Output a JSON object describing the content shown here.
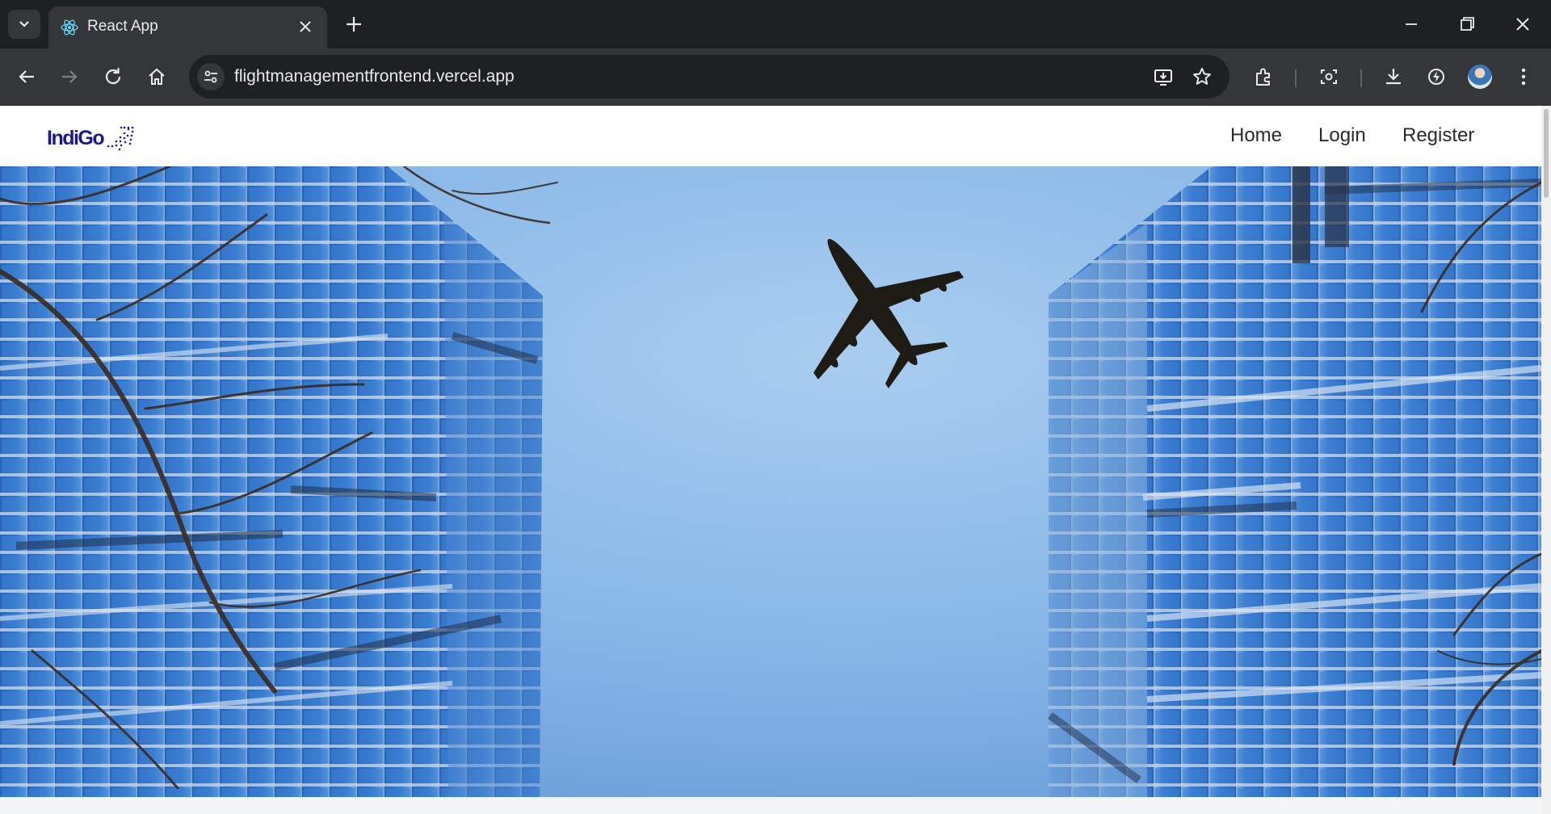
{
  "browser": {
    "tab": {
      "title": "React App",
      "favicon": "react-icon",
      "close_icon": "close-icon"
    },
    "new_tab_icon": "plus-icon",
    "window_controls": [
      "minimize-icon",
      "restore-icon",
      "close-icon"
    ],
    "nav_icons": [
      "back-arrow-icon",
      "forward-arrow-icon",
      "reload-icon",
      "home-icon"
    ],
    "address": {
      "url": "flightmanagementfrontend.vercel.app",
      "site_info_icon": "tune-icon"
    },
    "omnibox_icons": [
      "install-app-icon",
      "star-icon"
    ],
    "toolbar_icons": [
      "extensions-icon",
      "lens-icon",
      "download-icon",
      "performance-icon",
      "avatar",
      "kebab-menu-icon"
    ]
  },
  "navbar": {
    "logo_text": "IndiGo",
    "links": {
      "home": "Home",
      "login": "Login",
      "register": "Register"
    }
  },
  "colors": {
    "tabbar_bg": "#1f2023",
    "toolbar_bg": "#35363a",
    "logo": "#1a1a8c",
    "sky_light": "#bcd9f3",
    "sky_dark": "#5f95d2",
    "glass_blue": "#2f6ec6"
  },
  "hero": {
    "image": "airplane-between-skyscrapers"
  }
}
